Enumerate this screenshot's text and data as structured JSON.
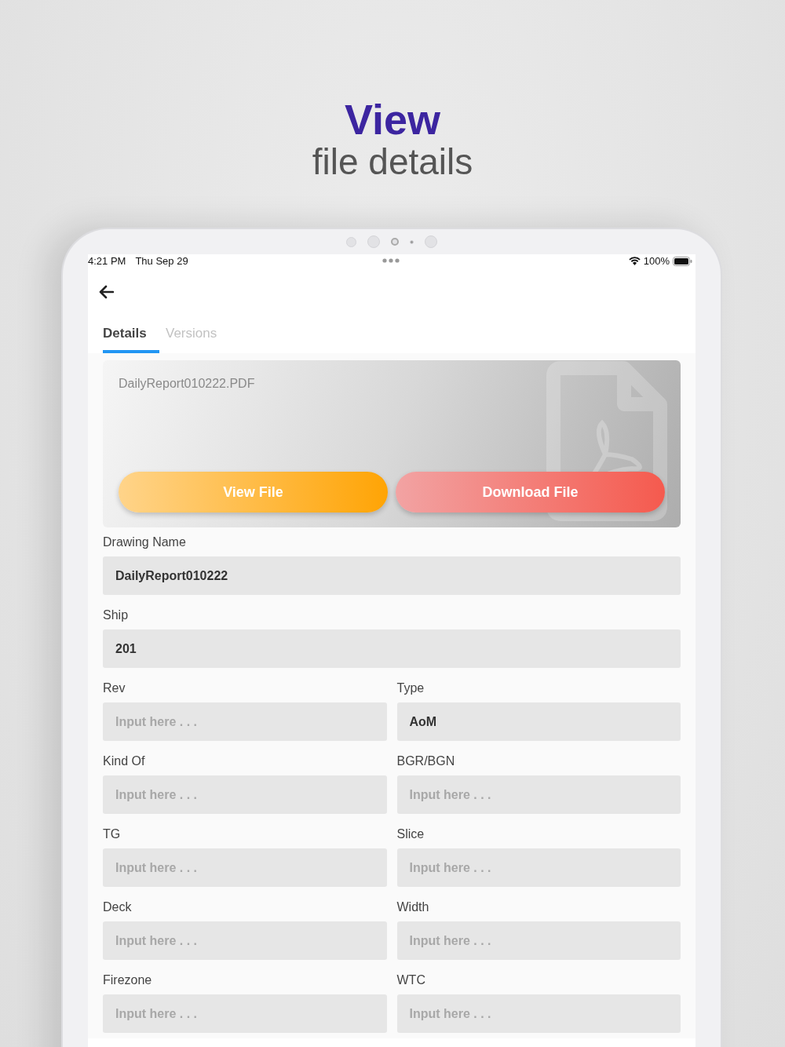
{
  "headline": {
    "title": "View",
    "subtitle": "file details"
  },
  "status_bar": {
    "time": "4:21 PM",
    "date": "Thu Sep 29",
    "battery": "100%"
  },
  "tabs": [
    {
      "label": "Details",
      "selected": true
    },
    {
      "label": "Versions",
      "selected": false
    }
  ],
  "file_card": {
    "file_name": "DailyReport010222.PDF",
    "buttons": [
      {
        "label": "View File",
        "kind": "view"
      },
      {
        "label": "Download File",
        "kind": "download"
      }
    ]
  },
  "fields": [
    {
      "label": "Drawing Name",
      "value": "DailyReport010222",
      "kind": "wide"
    },
    {
      "label": "Ship",
      "value": "201",
      "kind": "wide"
    },
    {
      "label": "Rev",
      "placeholder": "Input here . . .",
      "kind": "half"
    },
    {
      "label": "Type",
      "value": "AoM",
      "kind": "half"
    },
    {
      "label": "Kind Of",
      "placeholder": "Input here . . .",
      "kind": "half"
    },
    {
      "label": "BGR/BGN",
      "placeholder": "Input here . . .",
      "kind": "half"
    },
    {
      "label": "TG",
      "placeholder": "Input here . . .",
      "kind": "half"
    },
    {
      "label": "Slice",
      "placeholder": "Input here . . .",
      "kind": "half"
    },
    {
      "label": "Deck",
      "placeholder": "Input here . . .",
      "kind": "half"
    },
    {
      "label": "Width",
      "placeholder": "Input here . . .",
      "kind": "half"
    },
    {
      "label": "Firezone",
      "placeholder": "Input here . . .",
      "kind": "half"
    },
    {
      "label": "WTC",
      "placeholder": "Input here . . .",
      "kind": "half"
    }
  ]
}
